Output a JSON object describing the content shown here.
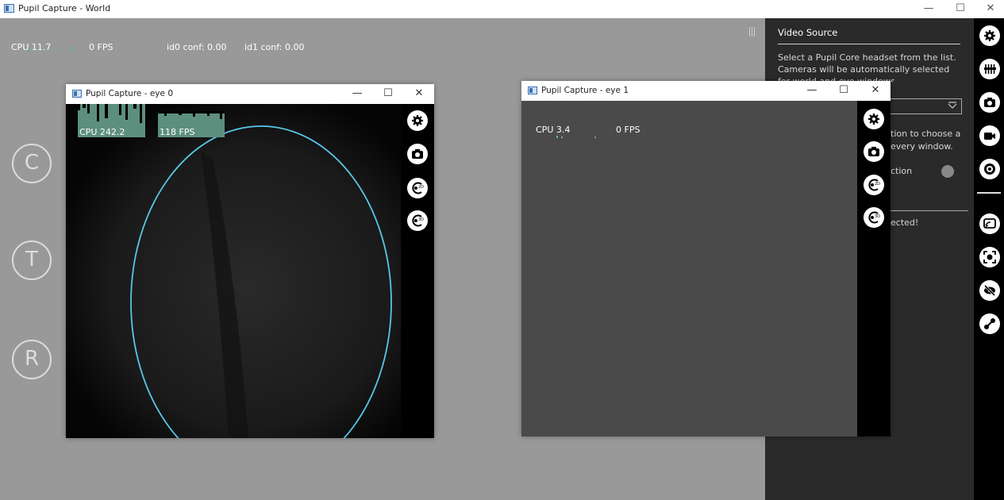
{
  "world": {
    "title": "Pupil Capture - World",
    "win_min": "—",
    "win_max": "☐",
    "win_close": "✕",
    "cpu_label": "CPU 11.7",
    "fps_label": "0 FPS",
    "id0_conf": "id0 conf: 0.00",
    "id1_conf": "id1 conf: 0.00",
    "calibration_buttons": [
      "C",
      "T",
      "R"
    ]
  },
  "side_panel": {
    "title": "Video Source",
    "description": "Select a Pupil Core headset from the list. Cameras will be automatically selected for world and eye windows.",
    "partial_text_1": "tion to choose a",
    "partial_text_2": "every window.",
    "partial_label": "ction",
    "partial_status": "ected!"
  },
  "icon_bar": {
    "icons": [
      "gear-icon",
      "sliders-icon",
      "camera-icon",
      "video-record-icon",
      "target-icon",
      "screen-cast-icon",
      "surface-tracker-icon",
      "eye-off-icon",
      "link-icon"
    ]
  },
  "eye0": {
    "title": "Pupil Capture - eye 0",
    "cpu_label": "CPU 242.2",
    "fps_label": "118 FPS",
    "win_min": "—",
    "win_max": "☐",
    "win_close": "✕",
    "ellipse_color": "#58c8e8"
  },
  "eye1": {
    "title": "Pupil Capture - eye 1",
    "cpu_label": "CPU 3.4",
    "fps_label": "0 FPS",
    "win_min": "—",
    "win_max": "☐",
    "win_close": "✕"
  },
  "eye_tools": [
    "gear-icon",
    "camera-icon",
    "pupil-2d-icon",
    "pupil-3d-icon"
  ]
}
